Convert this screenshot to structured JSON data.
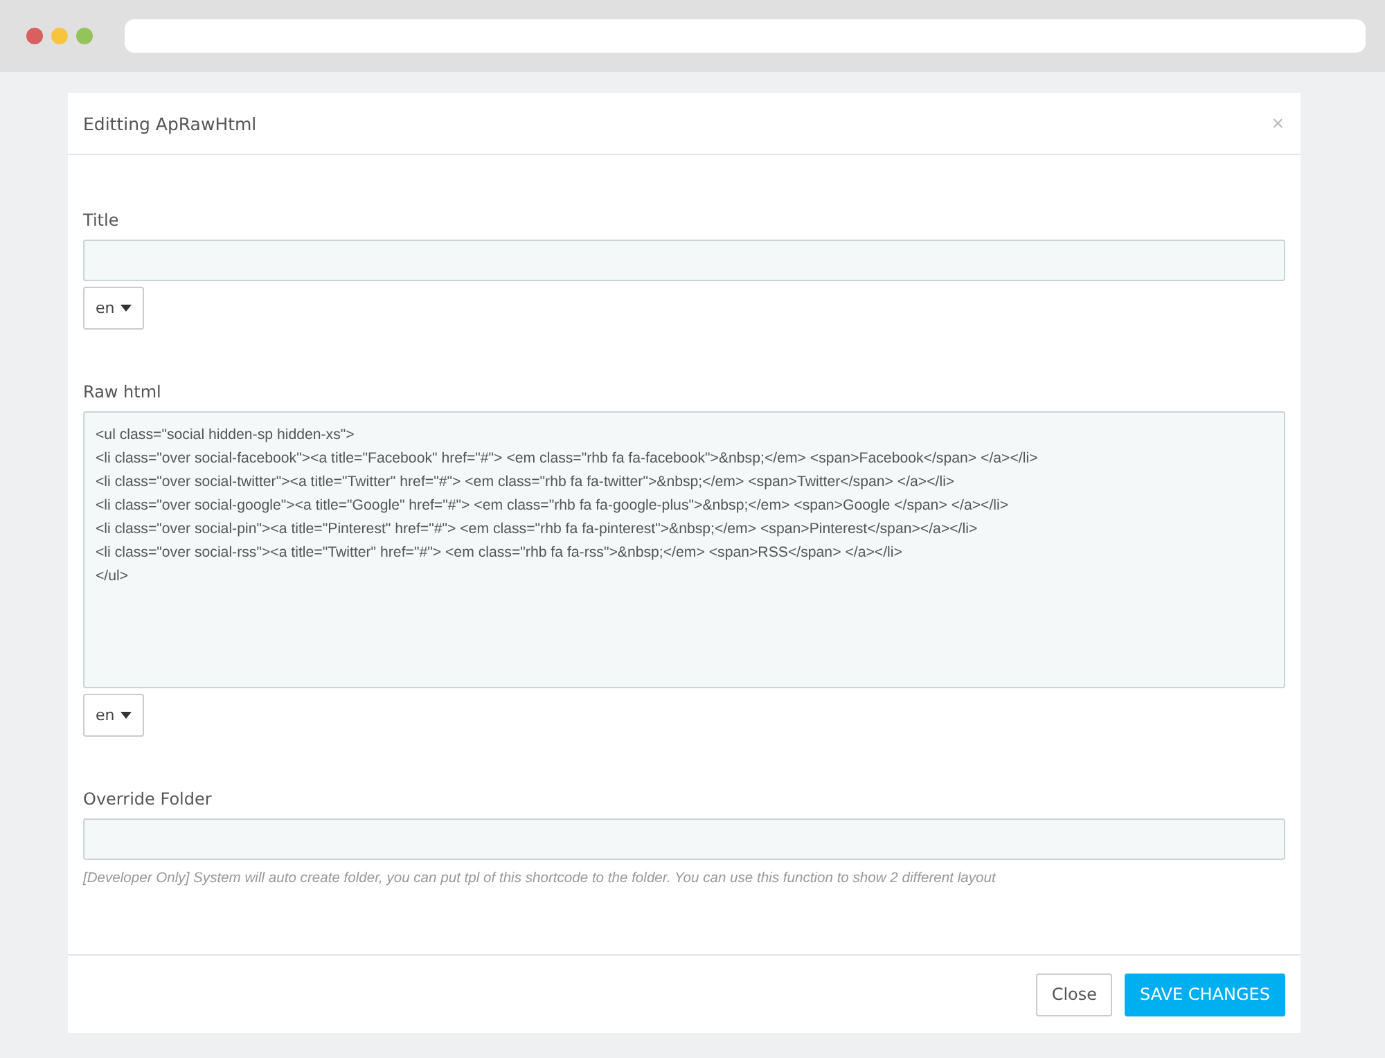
{
  "modal": {
    "title": "Editting ApRawHtml",
    "close": "×"
  },
  "fields": [
    {
      "kind": "input",
      "label": "Title",
      "language": "en"
    },
    {
      "kind": "code",
      "label": "Raw html",
      "lines": [
        "<ul class=\"social hidden-sp hidden-xs\">",
        "<li class=\"over social-facebook\"><a title=\"Facebook\" href=\"#\"> <em class=\"rhb fa fa-facebook\">&nbsp;</em> <span>Facebook</span> </a></li>",
        "<li class=\"over social-twitter\"><a title=\"Twitter\" href=\"#\"> <em class=\"rhb fa fa-twitter\">&nbsp;</em> <span>Twitter</span> </a></li>",
        "<li class=\"over social-google\"><a title=\"Google\" href=\"#\"> <em class=\"rhb fa fa-google-plus\">&nbsp;</em> <span>Google </span> </a></li>",
        "<li class=\"over social-pin\"><a title=\"Pinterest\" href=\"#\"> <em class=\"rhb fa fa-pinterest\">&nbsp;</em> <span>Pinterest</span></a></li>",
        "<li class=\"over social-rss\"><a title=\"Twitter\" href=\"#\"> <em class=\"rhb fa fa-rss\">&nbsp;</em> <span>RSS</span> </a></li>",
        "</ul>"
      ],
      "language": "en"
    },
    {
      "kind": "input",
      "label": "Override Folder",
      "help": "[Developer Only] System will auto create folder, you can put tpl of this shortcode to the folder. You can use this function to show 2 different layout"
    }
  ],
  "buttons": [
    {
      "label": "Close",
      "kind": "default"
    },
    {
      "label": "SAVE CHANGES",
      "kind": "primary"
    }
  ]
}
